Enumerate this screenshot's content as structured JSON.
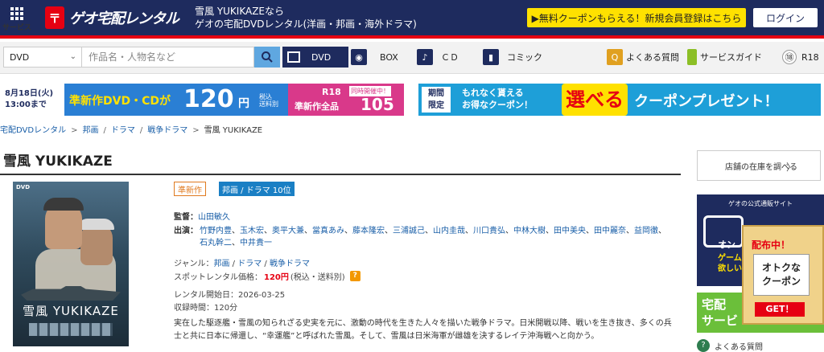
{
  "header": {
    "service_label": "サービス",
    "logo_text": "ゲオ宅配レンタル",
    "title_line1": "雪風 YUKIKAZEなら",
    "title_line2": "ゲオの宅配DVDレンタル(洋画・邦画・海外ドラマ)",
    "promo_label": "▶無料クーポンもらえる！新規会員登録はこちら",
    "login_label": "ログイン"
  },
  "search": {
    "category_value": "DVD",
    "placeholder": "作品名・人物名など"
  },
  "nav": {
    "dvd": "DVD",
    "box": "BOX",
    "cd": "ＣＤ",
    "comic": "コミック",
    "faq": "よくある質問",
    "guide": "サービスガイド",
    "r18_icon": "⑱",
    "r18": "R18"
  },
  "banners": {
    "b1_date_line1": "8月18日(火)",
    "b1_date_line2": "13:00まで",
    "b1_msg": "準新作DVD・CDが",
    "b1_price": "120",
    "b1_yen": "円",
    "b1_tax_line1": "税込",
    "b1_tax_line2": "送料別",
    "b1_r18": "R18",
    "b1_r18_msg": "準新作全品",
    "b1_r18_tag": "同時開催中！",
    "b1_r18_price": "105円",
    "b2_limited_line1": "期間",
    "b2_limited_line2": "限定",
    "b2_msg_line1": "もれなく貰える",
    "b2_msg_line2": "お得なクーポン！",
    "b2_select": "選べる",
    "b2_text": "クーポンプレゼント！"
  },
  "breadcrumb": [
    "宅配DVDレンタル",
    "邦画",
    "ドラマ",
    "戦争ドラマ",
    "雪風 YUKIKAZE"
  ],
  "title": "雪風 YUKIKAZE",
  "cover": {
    "dvd_tag": "DVD",
    "title": "雪風 YUKIKAZE"
  },
  "badges": {
    "new": "準新作",
    "rank": "邦画 / ドラマ 10位"
  },
  "details": {
    "director_label": "監督：",
    "director": "山田敏久",
    "cast_label": "出演：",
    "cast": [
      "竹野内豊",
      "玉木宏",
      "奥平大兼",
      "當真あみ",
      "藤本隆宏",
      "三浦誠己",
      "山内圭哉",
      "川口貴弘",
      "中林大樹",
      "田中美央",
      "田中麗奈",
      "益岡徹",
      "石丸幹二",
      "中井貴一"
    ],
    "genre_label": "ジャンル：",
    "genres": [
      "邦画",
      "ドラマ",
      "戦争ドラマ"
    ],
    "spot_label": "スポットレンタル価格：",
    "spot_price": "120円",
    "spot_tax": "(税込・送料別)",
    "spot_help": "?",
    "start": "レンタル開始日：2026-03-25",
    "duration": "収録時間：120分",
    "synopsis": "実在した駆逐艦・雪風の知られざる史実を元に、激動の時代を生きた人々を描いた戦争ドラマ。日米開戦以降、戦いを生き抜き、多くの兵士と共に日本に帰還し、“幸運艦”と呼ばれた雪風。そして、雪風は日米海軍が雌雄を決するレイテ沖海戦へと向かう。"
  },
  "sidebar": {
    "stock_label": "店舗の在庫を調べる",
    "stock_arrow": "〉",
    "ad_top": "ゲオの公式通販サイト",
    "ad_name": "オン",
    "ad_sub_line1": "ゲーム",
    "ad_sub_line2": "欲しい商",
    "ad2_line1": "宅配",
    "ad2_line2": "サービ",
    "coupon_top": "配布中！",
    "coupon_mid_line1": "オトクな",
    "coupon_mid_line2": "クーポン",
    "coupon_get": "GET！",
    "help_label": "よくある質問"
  }
}
